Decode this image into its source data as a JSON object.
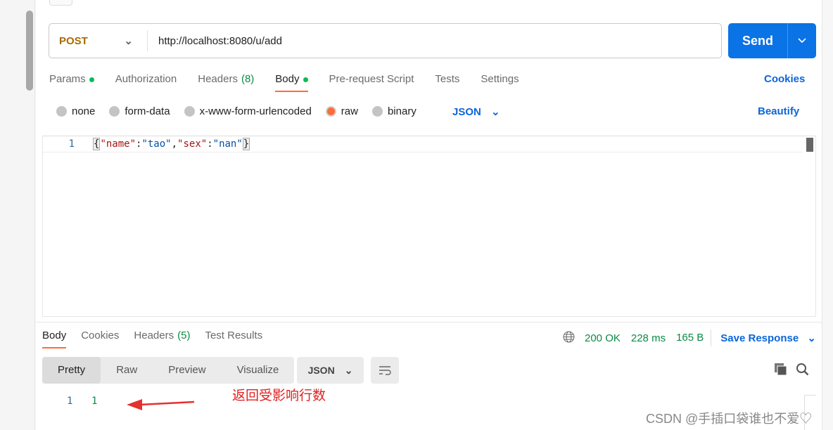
{
  "request": {
    "method": "POST",
    "url": "http://localhost:8080/u/add",
    "send_label": "Send"
  },
  "req_tabs": [
    {
      "label": "Params",
      "dot": true
    },
    {
      "label": "Authorization"
    },
    {
      "label": "Headers",
      "count": "(8)"
    },
    {
      "label": "Body",
      "dot": true,
      "active": true
    },
    {
      "label": "Pre-request Script"
    },
    {
      "label": "Tests"
    },
    {
      "label": "Settings"
    }
  ],
  "cookies_label": "Cookies",
  "body_types": [
    "none",
    "form-data",
    "x-www-form-urlencoded",
    "raw",
    "binary"
  ],
  "body_selected": "raw",
  "body_format": "JSON",
  "beautify_label": "Beautify",
  "editor": {
    "line_number": "1",
    "open": "{",
    "k1": "\"name\"",
    "v1": "\"tao\"",
    "k2": "\"sex\"",
    "v2": "\"nan\"",
    "close": "}"
  },
  "resp_tabs": [
    {
      "label": "Body",
      "active": true
    },
    {
      "label": "Cookies"
    },
    {
      "label": "Headers",
      "count": "(5)"
    },
    {
      "label": "Test Results"
    }
  ],
  "status": {
    "code": "200 OK",
    "time": "228 ms",
    "size": "165 B"
  },
  "save_response": "Save Response",
  "view_modes": [
    "Pretty",
    "Raw",
    "Preview",
    "Visualize"
  ],
  "view_selected": "Pretty",
  "resp_format": "JSON",
  "response": {
    "line_number": "1",
    "value": "1"
  },
  "annotation": "返回受影响行数",
  "watermark": "CSDN @手插口袋谁也不爱♡",
  "colors": {
    "accent": "#ff6c37",
    "send": "#0a73e6",
    "status": "#0c8a45"
  }
}
